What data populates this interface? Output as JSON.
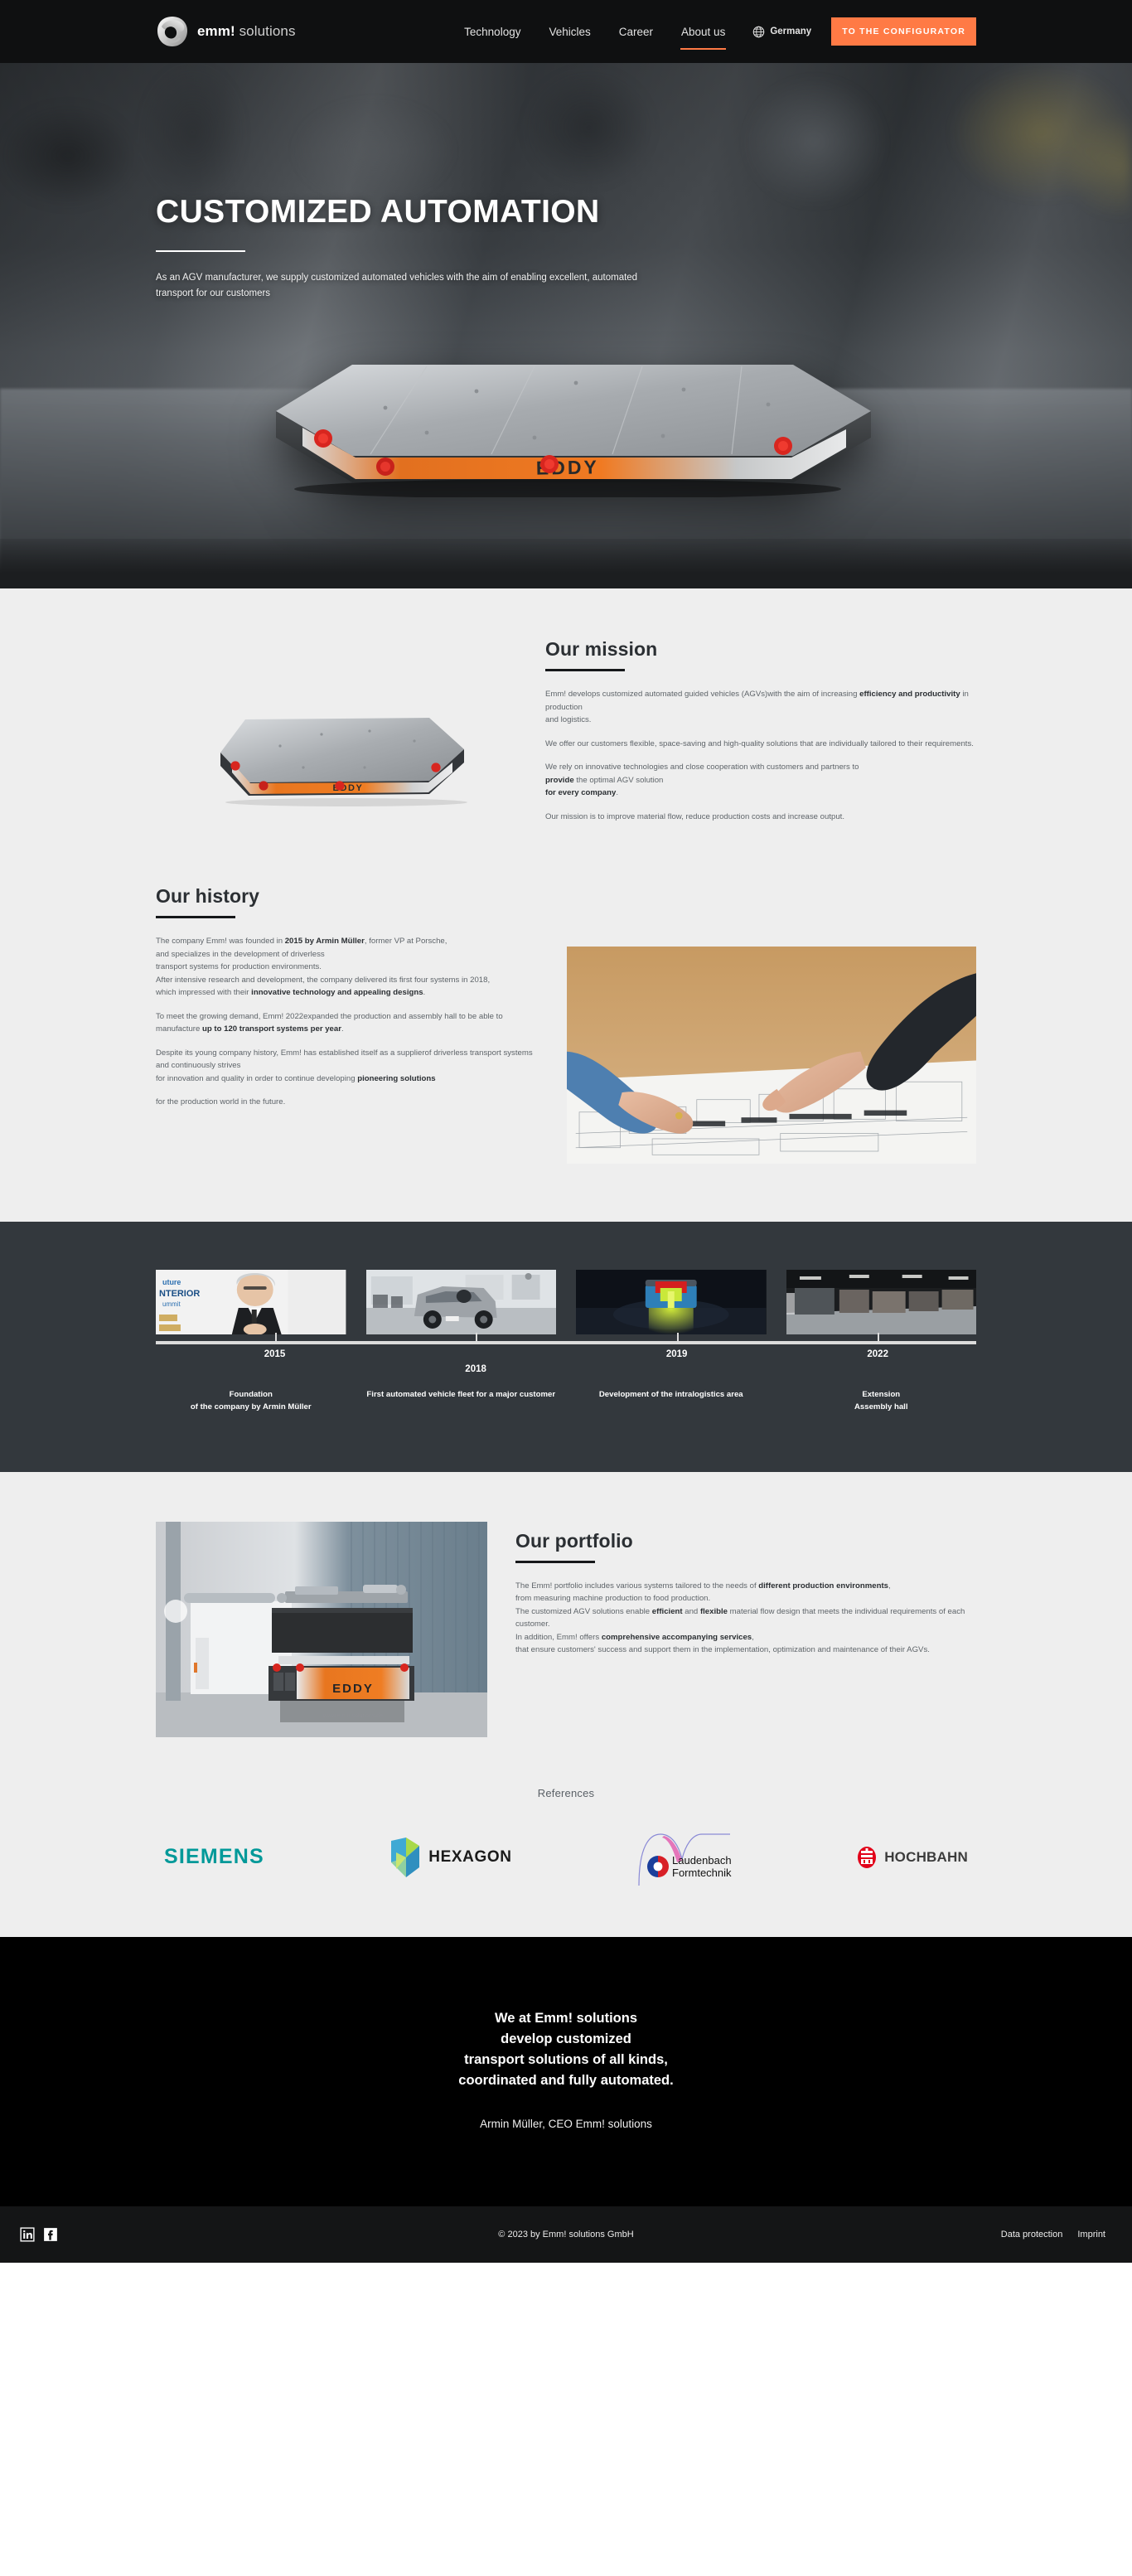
{
  "header": {
    "brand": {
      "bold": "emm!",
      "light": " solutions",
      "logo_icon": "emm-logo-icon"
    },
    "nav": [
      {
        "label": "Technology",
        "active": false
      },
      {
        "label": "Vehicles",
        "active": false
      },
      {
        "label": "Career",
        "active": false
      },
      {
        "label": "About us",
        "active": true
      }
    ],
    "language": {
      "label": "Germany",
      "icon": "globe-icon"
    },
    "cta_label": "TO THE CONFIGURATOR",
    "accent_color": "#ff7a45",
    "background_color": "#0f1011"
  },
  "hero": {
    "title": "CUSTOMIZED AUTOMATION",
    "subtitle": "As an AGV manufacturer, we supply customized automated vehicles with the aim of enabling excellent, automated transport for our customers",
    "vehicle_badge": "EDDY"
  },
  "mission": {
    "title": "Our mission",
    "image_alt": "EDDY AGV platform vehicle",
    "paragraphs": [
      {
        "parts": [
          {
            "t": "Emm! develops customized automated guided vehicles (AGVs)with the aim of increasing ",
            "b": false
          },
          {
            "t": "efficiency and productivity",
            "b": true
          },
          {
            "t": " in production",
            "b": false
          },
          {
            "t": "\nand logistics.",
            "b": false
          }
        ]
      },
      {
        "parts": [
          {
            "t": "We offer our customers flexible, space-saving and high-quality solutions that are individually tailored to their requirements.",
            "b": false
          }
        ]
      },
      {
        "parts": [
          {
            "t": "We rely on innovative technologies and close cooperation with customers and partners to\n",
            "b": false
          },
          {
            "t": "provide",
            "b": true
          },
          {
            "t": " the optimal AGV solution\n",
            "b": false
          },
          {
            "t": "for every company",
            "b": true
          },
          {
            "t": ".",
            "b": false
          }
        ]
      },
      {
        "parts": [
          {
            "t": "Our mission is to improve material flow, reduce production costs and increase output.",
            "b": false
          }
        ]
      }
    ]
  },
  "history": {
    "title": "Our history",
    "image_alt": "Two people pointing at a technical floor-plan drawing",
    "paragraphs": [
      {
        "parts": [
          {
            "t": "The company Emm! was founded in ",
            "b": false
          },
          {
            "t": "2015 by Armin Müller",
            "b": true
          },
          {
            "t": ", former VP at Porsche,\nand specializes in the development of driverless\ntransport systems for production environments.\nAfter intensive research and development, the company delivered its first four systems in 2018,\nwhich impressed with their ",
            "b": false
          },
          {
            "t": "innovative technology and appealing designs",
            "b": true
          },
          {
            "t": ".",
            "b": false
          }
        ]
      },
      {
        "parts": [
          {
            "t": "To meet the growing demand, Emm! 2022expanded the production and assembly hall to be able to manufacture ",
            "b": false
          },
          {
            "t": "up to 120 transport systems per year",
            "b": true
          },
          {
            "t": ".",
            "b": false
          }
        ]
      },
      {
        "parts": [
          {
            "t": "Despite its young company history, Emm! has established itself as a supplierof driverless transport systems and continuously strives\nfor innovation and quality in order to continue developing ",
            "b": false
          },
          {
            "t": "pioneering solutions",
            "b": true
          }
        ]
      },
      {
        "parts": [
          {
            "t": "for the production world in the future.",
            "b": false
          }
        ]
      }
    ]
  },
  "timeline": {
    "entries": [
      {
        "year": "2015",
        "caption": "Foundation\nof the company by Armin Müller",
        "image_alt": "Armin Müller speaking at Future Interior Summit"
      },
      {
        "year": "2018",
        "caption": "First automated vehicle fleet for a major customer",
        "image_alt": "Small electric concept car in an office"
      },
      {
        "year": "2019",
        "caption": "Development of the intralogistics area",
        "image_alt": "Blue AGV projecting a green light beam"
      },
      {
        "year": "2022",
        "caption": "Extension\nAssembly hall",
        "image_alt": "Empty assembly hall interior"
      }
    ]
  },
  "portfolio": {
    "title": "Our portfolio",
    "image_alt": "EDDY AGV carrying a dark load module inside a production hall",
    "paragraphs": [
      {
        "parts": [
          {
            "t": "The Emm! portfolio includes various systems tailored to the needs of ",
            "b": false
          },
          {
            "t": "different production environments",
            "b": true
          },
          {
            "t": ",\nfrom measuring machine production to food production.\nThe customized AGV solutions enable ",
            "b": false
          },
          {
            "t": "efficient",
            "b": true
          },
          {
            "t": " and ",
            "b": false
          },
          {
            "t": "flexible",
            "b": true
          },
          {
            "t": " material flow design that meets the individual requirements of each\ncustomer.\nIn addition, Emm! offers ",
            "b": false
          },
          {
            "t": "comprehensive accompanying services",
            "b": true
          },
          {
            "t": ",\nthat ensure customers' success and support them in the implementation, optimization and maintenance of their AGVs.",
            "b": false
          }
        ]
      }
    ]
  },
  "references": {
    "title": "References",
    "logos": [
      {
        "name": "SIEMENS",
        "color": "#009999",
        "icon": "siemens-wordmark"
      },
      {
        "name": "HEXAGON",
        "color": "#1b1b1b",
        "icon": "hexagon-logo"
      },
      {
        "name": "Laudenbach Formtechnik",
        "line1": "Laudenbach",
        "line2": "Formtechnik",
        "icon": "laudenbach-logo"
      },
      {
        "name": "HOCHBAHN",
        "color": "#3c3c3c",
        "icon": "hochbahn-logo"
      }
    ]
  },
  "quote": {
    "text": "We at Emm! solutions\ndevelop customized\ntransport solutions of all kinds,\ncoordinated and fully automated.",
    "author": "Armin Müller, CEO Emm! solutions"
  },
  "footer": {
    "social": [
      {
        "name": "linkedin-icon"
      },
      {
        "name": "facebook-icon"
      }
    ],
    "copyright": "© 2023 by Emm! solutions GmbH",
    "links": [
      {
        "label": "Data protection"
      },
      {
        "label": "Imprint"
      }
    ]
  }
}
